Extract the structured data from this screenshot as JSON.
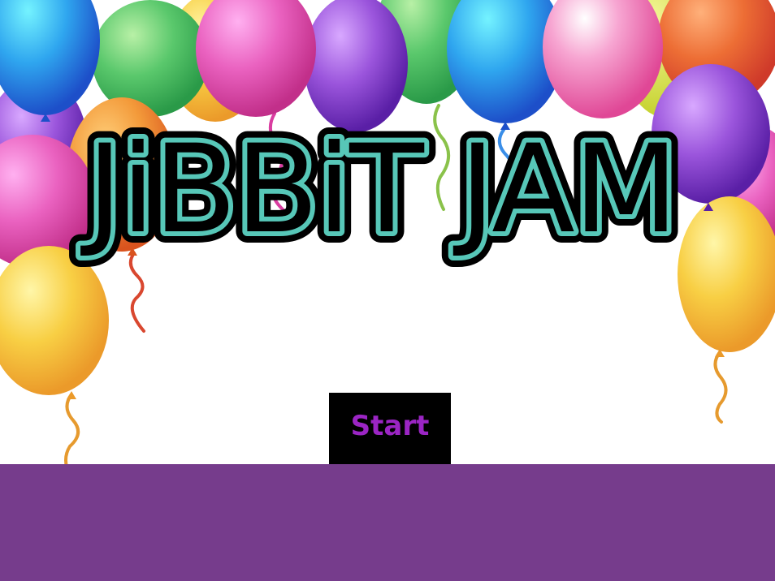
{
  "game": {
    "title": "JiBBiT JAM",
    "start_label": "Start"
  },
  "colors": {
    "title_fill": "#000000",
    "title_inner": "#57c7b8",
    "button_bg": "#000000",
    "button_text": "#9b25c4",
    "ground": "#763c8c",
    "background": "#ffffff"
  },
  "decoration": {
    "balloon_colors": [
      "#3a8ee8",
      "#57c46a",
      "#e85fb8",
      "#9b4fd6",
      "#f39a3a",
      "#f4c83f",
      "#e65a3a",
      "#f27ab0",
      "#d9dd45"
    ]
  }
}
